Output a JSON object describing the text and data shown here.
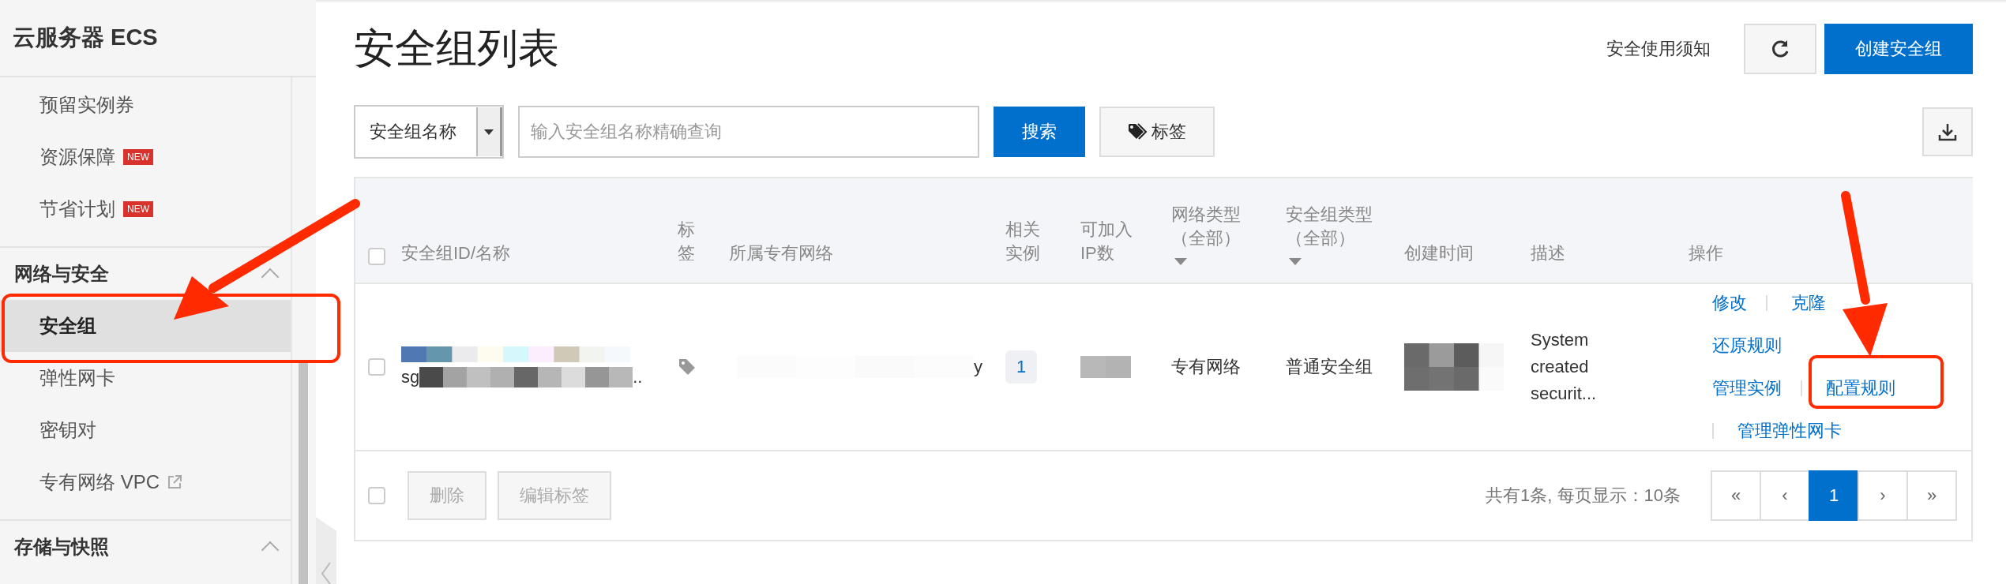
{
  "sidebar": {
    "title": "云服务器 ECS",
    "top_items": [
      {
        "label": "预留实例券",
        "selected": false
      },
      {
        "label": "资源保障",
        "badge": "NEW",
        "selected": false
      },
      {
        "label": "节省计划",
        "badge": "NEW",
        "selected": false
      }
    ],
    "groups": [
      {
        "title": "网络与安全",
        "expanded": true,
        "items": [
          {
            "label": "安全组",
            "selected": true
          },
          {
            "label": "弹性网卡",
            "selected": false
          },
          {
            "label": "密钥对",
            "selected": false
          },
          {
            "label": "专有网络 VPC",
            "external": true,
            "selected": false
          }
        ]
      },
      {
        "title": "存储与快照",
        "expanded": true
      }
    ]
  },
  "page": {
    "title": "安全组列表",
    "notice_link": "安全使用须知",
    "create_button": "创建安全组"
  },
  "filter": {
    "select": "安全组名称",
    "placeholder": "输入安全组名称精确查询",
    "search_button": "搜索",
    "tag_button": "标签"
  },
  "table": {
    "columns": [
      {
        "label": "安全组ID/名称"
      },
      {
        "label": "标签"
      },
      {
        "label": "所属专有网络"
      },
      {
        "label": "相关实例"
      },
      {
        "label": "可加入IP数"
      },
      {
        "label": "网络类型",
        "sub": "（全部）",
        "filter": true
      },
      {
        "label": "安全组类型",
        "sub": "（全部）",
        "filter": true
      },
      {
        "label": "创建时间"
      },
      {
        "label": "描述"
      },
      {
        "label": "操作"
      }
    ],
    "select_all_checked": false,
    "rows": [
      {
        "checked": false,
        "name_start": "sg",
        "name_end": "..",
        "vpc_end": "y",
        "instances": "1",
        "network_type": "专有网络",
        "group_type": "普通安全组",
        "description": "System created securit...",
        "actions": [
          "修改",
          "克隆",
          "还原规则",
          "管理实例",
          "配置规则",
          "管理弹性网卡"
        ]
      }
    ],
    "footer": {
      "checked": false,
      "buttons": [
        {
          "label": "删除",
          "disabled": true
        },
        {
          "label": "编辑标签",
          "disabled": true
        }
      ],
      "summary": "共有1条, 每页显示：10条",
      "pages": [
        {
          "label": "«",
          "selected": false
        },
        {
          "label": "‹",
          "selected": false
        },
        {
          "label": "1",
          "selected": true
        },
        {
          "label": "›",
          "selected": false
        },
        {
          "label": "»",
          "selected": false
        }
      ]
    }
  }
}
